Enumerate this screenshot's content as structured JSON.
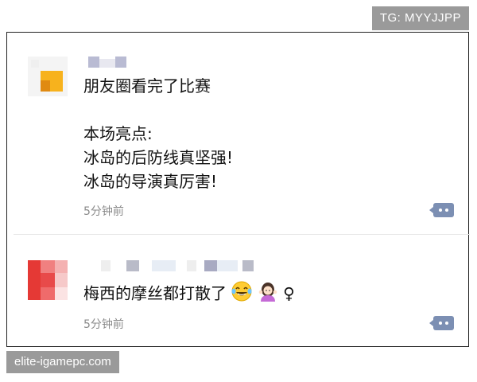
{
  "watermarks": {
    "top": "TG: MYYJJPP",
    "bottom": "elite-igamepc.com"
  },
  "posts": [
    {
      "lines": [
        "朋友圈看完了比赛",
        "",
        "本场亮点:",
        "冰岛的后防线真坚强!",
        "冰岛的导演真厉害!"
      ],
      "time": "5分钟前"
    },
    {
      "text": "梅西的摩丝都打散了",
      "emojis": [
        "tears-of-joy",
        "shrug-woman"
      ],
      "trailing": "♀",
      "time": "5分钟前"
    }
  ],
  "colors": {
    "comment_button": "#7c8fb3",
    "time_text": "#8a8a8a",
    "avatar1": "#f4b400",
    "avatar2": "#e53935"
  }
}
